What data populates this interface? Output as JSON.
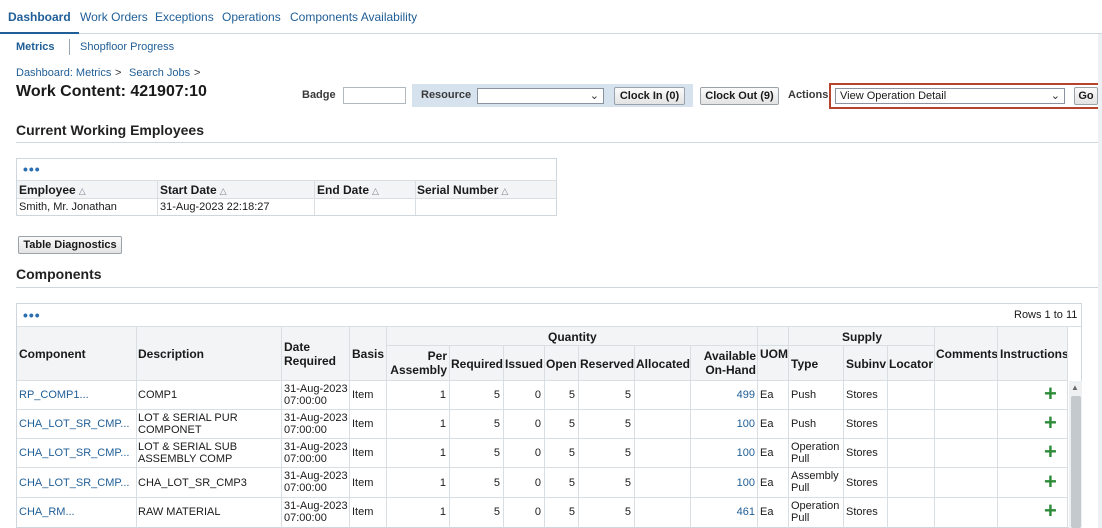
{
  "tabs": [
    "Dashboard",
    "Work Orders",
    "Exceptions",
    "Operations",
    "Components Availability"
  ],
  "subtabs": [
    "Metrics",
    "Shopfloor Progress"
  ],
  "breadcrumb": [
    "Dashboard: Metrics",
    "Search Jobs"
  ],
  "breadcrumb_sep": ">",
  "page_title": "Work Content: 421907:10",
  "toolbar": {
    "badge_label": "Badge",
    "badge_value": "",
    "resource_label": "Resource",
    "resource_value": "",
    "clock_in_label": "Clock In (0)",
    "clock_out_label": "Clock Out (9)",
    "actions_label": "Actions",
    "actions_value": "View Operation Detail",
    "go_label": "Go"
  },
  "employees": {
    "title": "Current Working Employees",
    "menu": "•••",
    "columns": [
      "Employee",
      "Start Date",
      "End Date",
      "Serial Number"
    ],
    "rows": [
      [
        "Smith, Mr. Jonathan",
        "31-Aug-2023 22:18:27",
        "",
        ""
      ]
    ]
  },
  "diagnostics_label": "Table Diagnostics",
  "components": {
    "title": "Components",
    "menu": "•••",
    "rows_info": "Rows 1 to 11",
    "headers": {
      "component": "Component",
      "description": "Description",
      "date_required": "Date Required",
      "basis": "Basis",
      "quantity_group": "Quantity",
      "per_assembly": "Per Assembly",
      "required": "Required",
      "issued": "Issued",
      "open": "Open",
      "reserved": "Reserved",
      "allocated": "Allocated",
      "available": "Available On-Hand",
      "uom": "UOM",
      "supply_group": "Supply",
      "type": "Type",
      "subinv": "Subinv",
      "locator": "Locator",
      "comments": "Comments",
      "instructions": "Instructions"
    },
    "rows": [
      {
        "component": "RP_COMP1...",
        "description": "COMP1",
        "date": "31-Aug-2023",
        "time": "07:00:00",
        "basis": "Item",
        "per": "1",
        "required": "5",
        "issued": "0",
        "open": "5",
        "reserved": "5",
        "allocated": "",
        "available": "499",
        "uom": "Ea",
        "type": "Push",
        "subinv": "Stores",
        "locator": ""
      },
      {
        "component": "CHA_LOT_SR_CMP...",
        "description": "LOT & SERIAL PUR COMPONET",
        "date": "31-Aug-2023",
        "time": "07:00:00",
        "basis": "Item",
        "per": "1",
        "required": "5",
        "issued": "0",
        "open": "5",
        "reserved": "5",
        "allocated": "",
        "available": "100",
        "uom": "Ea",
        "type": "Push",
        "subinv": "Stores",
        "locator": ""
      },
      {
        "component": "CHA_LOT_SR_CMP...",
        "description": "LOT & SERIAL SUB ASSEMBLY COMP",
        "date": "31-Aug-2023",
        "time": "07:00:00",
        "basis": "Item",
        "per": "1",
        "required": "5",
        "issued": "0",
        "open": "5",
        "reserved": "5",
        "allocated": "",
        "available": "100",
        "uom": "Ea",
        "type": "Operation Pull",
        "subinv": "Stores",
        "locator": ""
      },
      {
        "component": "CHA_LOT_SR_CMP...",
        "description": "CHA_LOT_SR_CMP3",
        "date": "31-Aug-2023",
        "time": "07:00:00",
        "basis": "Item",
        "per": "1",
        "required": "5",
        "issued": "0",
        "open": "5",
        "reserved": "5",
        "allocated": "",
        "available": "100",
        "uom": "Ea",
        "type": "Assembly Pull",
        "subinv": "Stores",
        "locator": ""
      },
      {
        "component": "CHA_RM...",
        "description": "RAW MATERIAL",
        "date": "31-Aug-2023",
        "time": "07:00:00",
        "basis": "Item",
        "per": "1",
        "required": "5",
        "issued": "0",
        "open": "5",
        "reserved": "5",
        "allocated": "",
        "available": "461",
        "uom": "Ea",
        "type": "Operation Pull",
        "subinv": "Stores",
        "locator": ""
      }
    ]
  }
}
